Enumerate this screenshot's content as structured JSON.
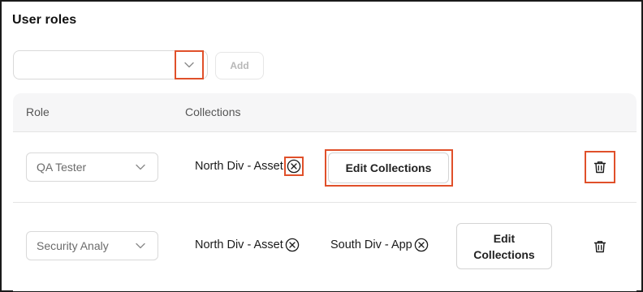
{
  "section_title": "User roles",
  "role_picker": {
    "value": "",
    "dropdown_icon": "chevron-down-icon"
  },
  "add_label": "Add",
  "table": {
    "headers": [
      "Role",
      "Collections"
    ],
    "rows": [
      {
        "role": "QA Tester",
        "collections": [
          "North Div - Asset"
        ],
        "edit_label": "Edit Collections"
      },
      {
        "role": "Security Analy",
        "collections": [
          "North Div - Asset",
          "South Div - App"
        ],
        "edit_label_line1": "Edit",
        "edit_label_line2": "Collections"
      }
    ]
  },
  "icons": {
    "remove": "close-circle-icon",
    "delete": "trash-icon"
  },
  "colors": {
    "highlight": "#e0502a",
    "header_bg": "#f6f6f7",
    "border": "#d9d9d9",
    "muted_text": "#b8b8b8"
  }
}
